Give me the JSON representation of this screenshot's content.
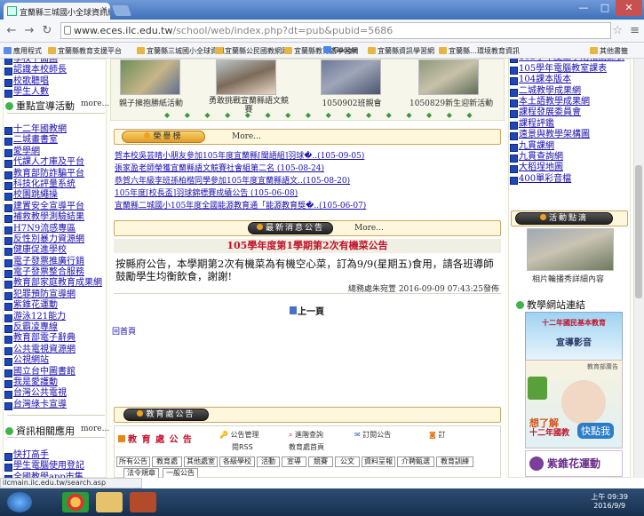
{
  "browser": {
    "tab_title": "宜蘭縣三城國小全球資訊網",
    "tab_close": "×",
    "url_host": "www.eces.ilc.edu.tw",
    "url_path": "/school/web/index.php?dt=pub&pubid=5686",
    "bookmarks": [
      "應用程式",
      "宜蘭縣教育支援平台",
      "宜蘭縣三城國小全球資訊",
      "宜蘭縣公民國教網路",
      "宜蘭縣教育處學習網",
      "宜蘭縣教育處學習網",
      "Google",
      "宜蘭縣資訊學習網",
      "宜蘭縣…環境教育資訊"
    ],
    "other_bookmarks": "其他書籤",
    "status_url": "ilcmain.ilc.edu.tw/search.asp",
    "win_min": "—",
    "win_max": "□",
    "win_close": "✕"
  },
  "left": {
    "top_items": [
      "學校平面圖",
      "認識本校師長",
      "校歌聽唱",
      "學生人數"
    ],
    "section1_title": "重點宣導活動",
    "more_label": "more...",
    "section1_items": [
      "十二年國教網",
      "二城畫書室",
      "愛學網",
      "代課人才庫及平台",
      "教育部防詐騙平台",
      "科技化評量系統",
      "校園跳繩操",
      "建置安全宣導平台",
      "補救教學測驗結果",
      "H7N9流感專區",
      "反性別暴力資源網",
      "健康促進學校",
      "電子發票推廣行銷",
      "電子發票整合服務",
      "教育部家庭教育成果網",
      "犯罪預防宣導網",
      "紫錐花運動",
      "游泳121能力",
      "反霸凌專線",
      "教育部電子辭典",
      "公共電視資源網",
      "公視網站",
      "國立台中圖書館",
      "我是愛護動",
      "台灣公共電視",
      "台灣綠卡宣導"
    ],
    "section2_title": "資訊相關應用",
    "section2_items": [
      "快打高手",
      "學生電腦使用登記",
      "全國教學app市集"
    ]
  },
  "middle": {
    "photos": [
      {
        "caption": "親子擁抱勝紙活動"
      },
      {
        "caption": "勇敢挑戰宣蘭縣語文競賽"
      },
      {
        "caption": "1050902班親會"
      },
      {
        "caption": "1050829新生迎新活動"
      }
    ],
    "honor_title": "榮譽榜",
    "more_label": "More...",
    "honor_items": [
      "賀本校吳芸晴小朋友參加105年度宜蘭縣[閩語組]羽球�..(105-09-05)",
      "張家盈老師榮獲宜蘭縣語文競賽社會組第二名 (105-08-24)",
      "恭賀六年級李班孫柏楷同學參加105年度宜蘭縣語文..(105-08-20)",
      "105年度[校長盃]羽球錦標賽成績公告 (105-06-08)",
      "宜蘭縣二城國小105年度全國能源教育通「能源教育獎�..(105-06-07)"
    ],
    "news_title": "最新消息公告",
    "news_headline": "105學年度第1學期第2次有機菜公告",
    "news_body": "按縣府公告，本學期第2次有機菜為有機空心菜，訂為9/9(星期五)食用，請各班導師鼓勵學生均衡飲食，謝謝!",
    "news_meta": "總務處朱宛萱  2016-09-09 07:43:25發佈",
    "prev_page": "上一頁",
    "home_link": "回首頁",
    "edu_title": "教育處公告",
    "edu_box_title": "教 育 處 公 告",
    "edu_links": [
      "公告管理",
      "閱RSS",
      "進階查詢",
      "教育處首頁",
      "訂閱公告",
      "訂"
    ],
    "edu_tabs": [
      "所有公告",
      "教育處",
      "其他處室",
      "各級學校",
      "活動",
      "宣導",
      "競賽",
      "公文",
      "資料呈報",
      "介聘甄選",
      "教育訓練",
      "法令規章",
      "一般公告"
    ]
  },
  "right": {
    "items": [
      "相關教學進度與評量規劃平台",
      "105學年度上學期相關課表",
      "105學年電腦教室課表",
      "104課本版本",
      "二城教學成果網",
      "本土語教學成果網",
      "課程發展委員會",
      "課程評鑑",
      "遠景與教學架構圖",
      "九貫課網",
      "九貫查詢網",
      "大稻埕地圖",
      "400單彩音檔"
    ],
    "activity_title": "活動點滴",
    "activity_caption": "相片輪播秀詳細內容",
    "links_title": "教學網站連結",
    "ad1_title": "十二年國民基本教育",
    "ad1_sub": "宣導影音",
    "ad2_title": "十二年國教",
    "ad2_big": "快點我",
    "ad2_tag": "教育部廣告",
    "ad2_top": "想了解",
    "ad3_title": "紫錐花運動"
  },
  "taskbar": {
    "time": "上午 09:39",
    "date": "2016/9/9"
  }
}
